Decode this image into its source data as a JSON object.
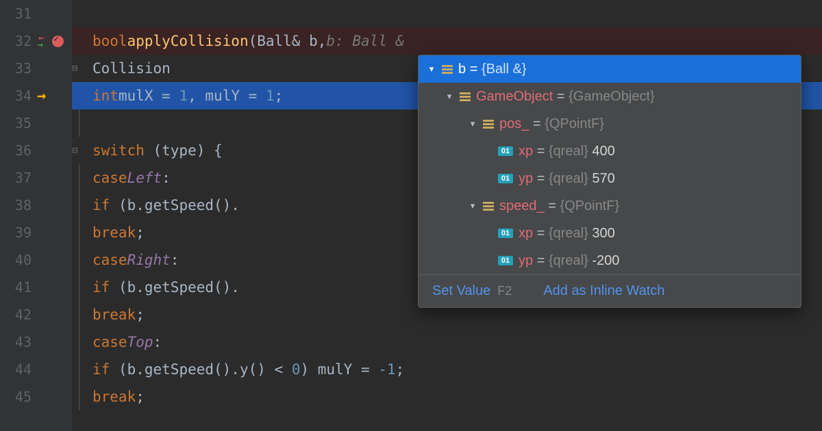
{
  "gutter": {
    "lines": [
      "31",
      "32",
      "33",
      "34",
      "35",
      "36",
      "37",
      "38",
      "39",
      "40",
      "41",
      "42",
      "43",
      "44",
      "45"
    ]
  },
  "code": {
    "l32": {
      "kw": "bool",
      "fn": "applyCollision",
      "p1": "(Ball& b,",
      "hint": "b: Ball &"
    },
    "l33": {
      "txt": "Collision"
    },
    "l34": {
      "kw": "int",
      "v1": "mulX",
      "eq1": " = ",
      "n1": "1",
      "c1": ", ",
      "v2": "mulY",
      "eq2": " = ",
      "n2": "1",
      "end": ";"
    },
    "l36": {
      "kw": "switch",
      "txt": " (type) {"
    },
    "l37": {
      "kw": "case",
      "enum": "Left",
      "colon": ":"
    },
    "l38": {
      "kw": "if",
      "txt": " (b.getSpeed()."
    },
    "l39": {
      "kw": "break",
      "end": ";"
    },
    "l40": {
      "kw": "case",
      "enum": "Right",
      "colon": ":"
    },
    "l41": {
      "kw": "if",
      "txt": " (b.getSpeed()."
    },
    "l42": {
      "kw": "break",
      "end": ";"
    },
    "l43": {
      "kw": "case",
      "enum": "Top",
      "colon": ":"
    },
    "l44": {
      "kw": "if",
      "txt1": " (b.getSpeed().y() < ",
      "n1": "0",
      "txt2": ") mulY = ",
      "n2": "-1",
      "end": ";"
    },
    "l45": {
      "kw": "break",
      "end": ";"
    }
  },
  "popup": {
    "rows": [
      {
        "name": "b",
        "type": "{Ball &}"
      },
      {
        "name": "GameObject",
        "type": "{GameObject}"
      },
      {
        "name": "pos_",
        "type": "{QPointF}"
      },
      {
        "name": "xp",
        "type": "{qreal}",
        "val": "400"
      },
      {
        "name": "yp",
        "type": "{qreal}",
        "val": "570"
      },
      {
        "name": "speed_",
        "type": "{QPointF}"
      },
      {
        "name": "xp",
        "type": "{qreal}",
        "val": "300"
      },
      {
        "name": "yp",
        "type": "{qreal}",
        "val": "-200"
      }
    ],
    "footer": {
      "setValue": "Set Value",
      "shortcut": "F2",
      "addWatch": "Add as Inline Watch"
    }
  }
}
